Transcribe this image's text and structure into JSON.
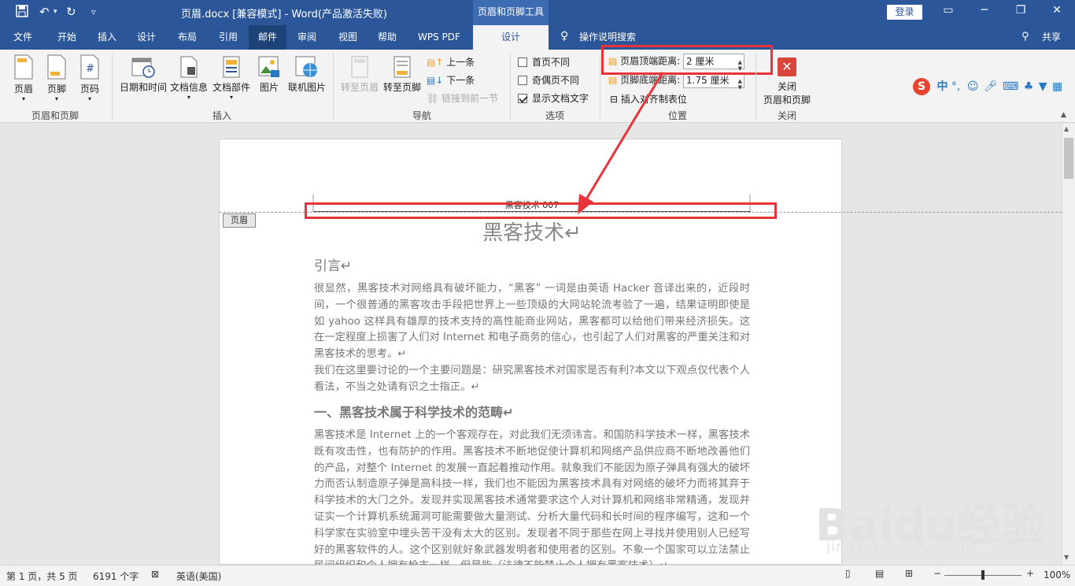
{
  "titlebar": {
    "doc_title": "页眉.docx [兼容模式]  -  Word(产品激活失败)",
    "context_group": "页眉和页脚工具",
    "login": "登录"
  },
  "tabs": [
    "文件",
    "开始",
    "插入",
    "设计",
    "布局",
    "引用",
    "邮件",
    "审阅",
    "视图",
    "帮助",
    "WPS PDF",
    "设计"
  ],
  "tell_me": "操作说明搜索",
  "share": "共享",
  "ribbon": {
    "hf_group": {
      "label": "页眉和页脚",
      "header": "页眉",
      "footer": "页脚",
      "page_number": "页码"
    },
    "insert_group": {
      "label": "插入",
      "date_time": "日期和时间",
      "doc_info": "文档信息",
      "doc_parts": "文档部件",
      "picture": "图片",
      "online_picture": "联机图片"
    },
    "nav_group": {
      "label": "导航",
      "goto_header": "转至页眉",
      "goto_footer": "转至页脚",
      "prev": "上一条",
      "next": "下一条",
      "link_prev": "链接到前一节"
    },
    "options_group": {
      "label": "选项",
      "diff_first": "首页不同",
      "diff_odd_even": "奇偶页不同",
      "show_text": "显示文档文字"
    },
    "position_group": {
      "label": "位置",
      "header_top": "页眉顶端距离:",
      "header_top_value": "2 厘米",
      "footer_bottom": "页脚底端距离:",
      "footer_bottom_value": "1.75 厘米",
      "insert_align_tab": "插入对齐制表位"
    },
    "close_group": {
      "label": "关闭",
      "close_line1": "关闭",
      "close_line2": "页眉和页脚"
    }
  },
  "ime": {
    "zh": "中",
    "punct": "°,"
  },
  "document": {
    "header_text": "黑客技术 007",
    "header_tag": "页眉",
    "title": "黑客技术↵",
    "h_intro": "引言↵",
    "p1": "很显然，黑客技术对网络具有破坏能力，“黑客” 一词是由英语 Hacker 音译出来的，近段时间，一个很普通的黑客攻击手段把世界上一些顶级的大网站轮流考验了一遍，结果证明即使是如 yahoo 这样具有雄厚的技术支持的高性能商业网站，黑客都可以给他们带来经济损失。这在一定程度上损害了人们对 Internet 和电子商务的信心，也引起了人们对黑客的严重关注和对黑客技术的思考。↵",
    "p2": "我们在这里要讨论的一个主要问题是：研究黑客技术对国家是否有利?本文以下观点仅代表个人看法，不当之处请有识之士指正。↵",
    "h1": "一、黑客技术属于科学技术的范畴↵",
    "p3": "黑客技术是 Internet 上的一个客观存在，对此我们无须讳言。和国防科学技术一样，黑客技术既有攻击性，也有防护的作用。黑客技术不断地促使计算机和网络产品供应商不断地改善他们的产品，对整个 Internet 的发展一直起着推动作用。就象我们不能因为原子弹具有强大的破坏力而否认制造原子弹是高科技一样，我们也不能因为黑客技术具有对网络的破坏力而将其弃于科学技术的大门之外。发现并实现黑客技术通常要求这个人对计算机和网络非常精通，发现并证实一个计算机系统漏洞可能需要做大量测试、分析大量代码和长时间的程序编写，这和一个科学家在实验室中埋头苦干没有太大的区别。发现者不同于那些在网上寻找并使用别人已经写好的黑客软件的人。这个区别就好象武器发明者和使用者的区别。不象一个国家可以立法禁止民间组织和个人拥有枪支一样，但是能（法律不能禁止个人拥有黑客技术）↵"
  },
  "statusbar": {
    "page": "第 1 页，共 5 页",
    "words": "6191 个字",
    "lang": "英语(美国)",
    "zoom": "100%"
  },
  "watermark": {
    "brand": "Baidu经验",
    "url": "jingyan.baidu.com"
  },
  "colors": {
    "accent": "#2b579a",
    "highlight": "#e8333a"
  }
}
